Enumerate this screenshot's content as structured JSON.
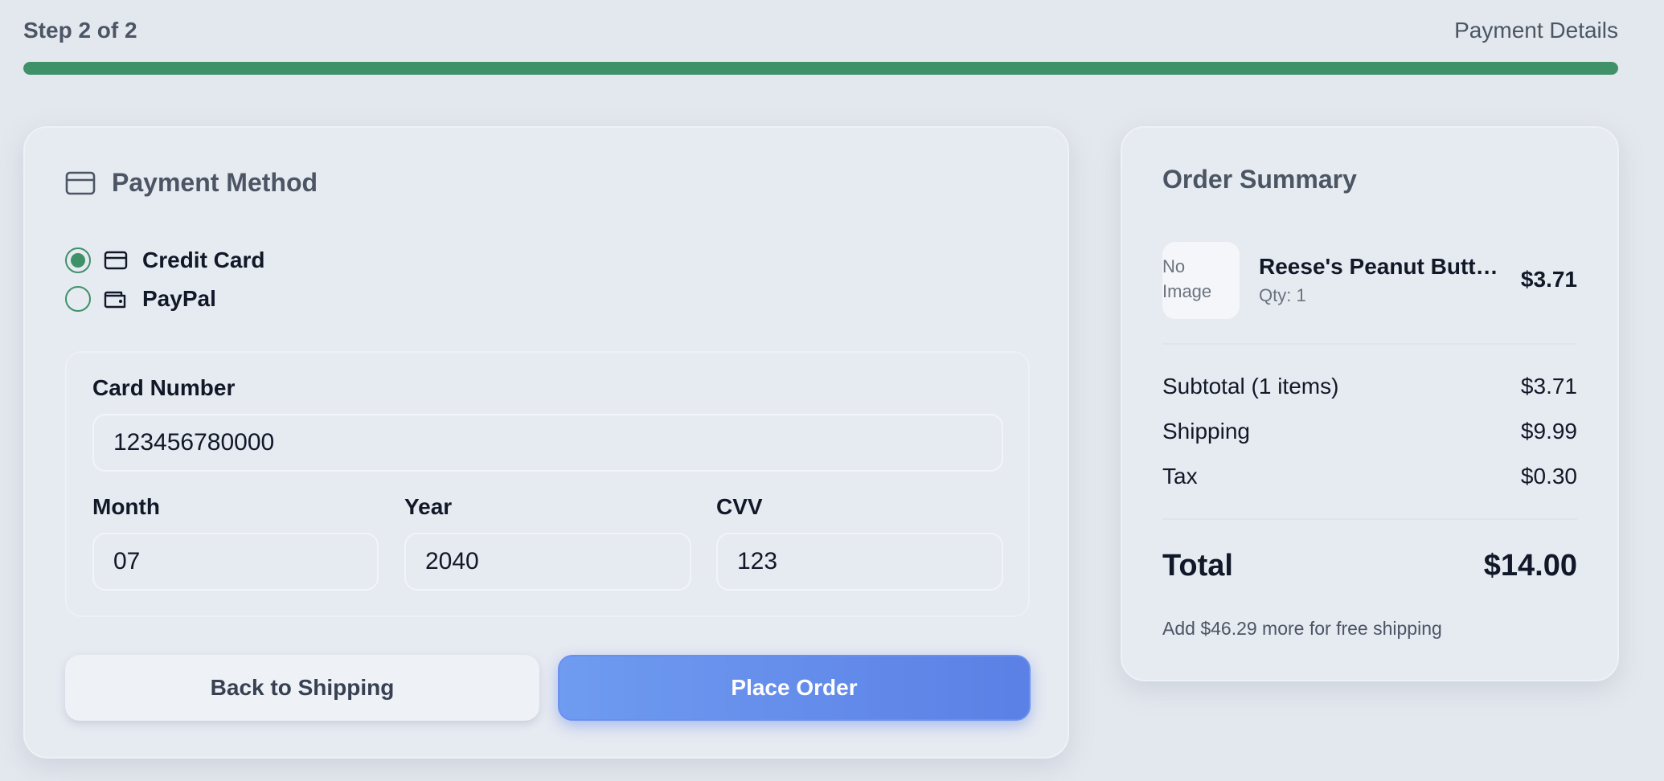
{
  "progress": {
    "step_label": "Step 2 of 2",
    "step_title": "Payment Details",
    "percent": 100,
    "color": "#3f9168"
  },
  "payment": {
    "title": "Payment Method",
    "title_icon": "credit-card-icon",
    "methods": [
      {
        "label": "Credit Card",
        "icon": "credit-card-icon",
        "selected": true
      },
      {
        "label": "PayPal",
        "icon": "wallet-icon",
        "selected": false
      }
    ],
    "card_number": {
      "label": "Card Number",
      "value": "123456780000"
    },
    "month": {
      "label": "Month",
      "value": "07"
    },
    "year": {
      "label": "Year",
      "value": "2040"
    },
    "cvv": {
      "label": "CVV",
      "value": "123"
    },
    "back_button": "Back to Shipping",
    "place_button": "Place Order"
  },
  "summary": {
    "title": "Order Summary",
    "item": {
      "image_line1": "No",
      "image_line2": "Image",
      "name": "Reese's Peanut Butte...",
      "qty": "Qty: 1",
      "price": "$3.71"
    },
    "subtotal": {
      "label": "Subtotal (1 items)",
      "value": "$3.71"
    },
    "shipping": {
      "label": "Shipping",
      "value": "$9.99"
    },
    "tax": {
      "label": "Tax",
      "value": "$0.30"
    },
    "total": {
      "label": "Total",
      "value": "$14.00"
    },
    "free_shipping_note": "Add $46.29 more for free shipping"
  },
  "colors": {
    "accent_green": "#3f9168",
    "primary_blue": "#5b80e6",
    "background": "#e3e7ee"
  }
}
